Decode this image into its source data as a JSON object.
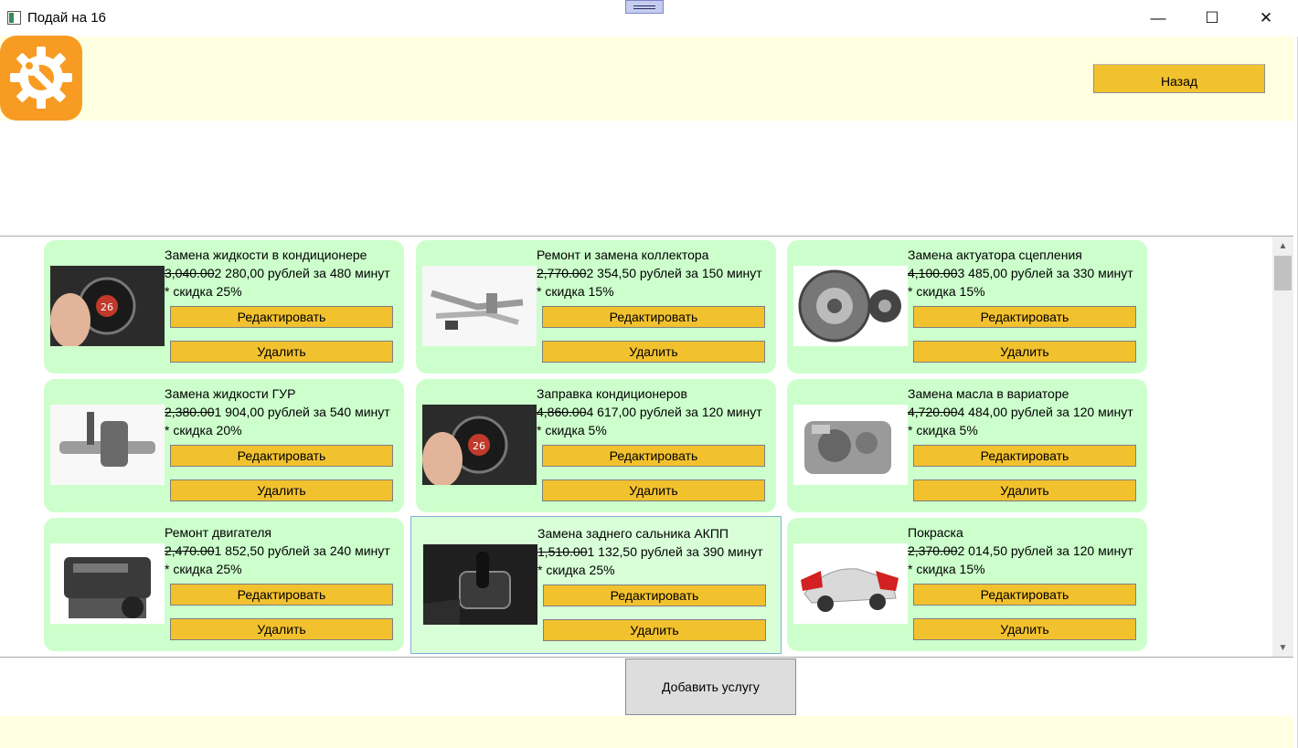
{
  "window": {
    "title": "Подай на 16",
    "controls": {
      "minimize": "—",
      "maximize": "☐",
      "close": "✕"
    }
  },
  "header": {
    "logo_icon": "wrench-gear-icon",
    "back_label": "Назад"
  },
  "colors": {
    "header_bg": "#ffffe1",
    "card_bg": "#ccffcc",
    "button_bg": "#f2c12e",
    "logo_bg": "#f79b22"
  },
  "services": [
    {
      "title": "Замена жидкости в кондиционере",
      "old_price": "3,040.00",
      "new_price": "2 280,00 рублей за 480 минут",
      "discount": "* скидка 25%",
      "image_icon": "ac-panel-image",
      "edit_label": "Редактировать",
      "delete_label": "Удалить"
    },
    {
      "title": "Ремонт и замена коллектора",
      "old_price": "2,770.00",
      "new_price": "2 354,50 рублей за 150 минут",
      "discount": "* скидка 15%",
      "image_icon": "exhaust-pipes-image",
      "edit_label": "Редактировать",
      "delete_label": "Удалить"
    },
    {
      "title": "Замена актуатора сцепления",
      "old_price": "4,100.00",
      "new_price": "3 485,00 рублей за 330 минут",
      "discount": "* скидка 15%",
      "image_icon": "clutch-kit-image",
      "edit_label": "Редактировать",
      "delete_label": "Удалить"
    },
    {
      "title": "Замена жидкости ГУР",
      "old_price": "2,380.00",
      "new_price": "1 904,00 рублей за 540 минут",
      "discount": "* скидка 20%",
      "image_icon": "steering-gear-image",
      "edit_label": "Редактировать",
      "delete_label": "Удалить"
    },
    {
      "title": "Заправка кондиционеров",
      "old_price": "4,860.00",
      "new_price": "4 617,00 рублей за 120 минут",
      "discount": "* скидка 5%",
      "image_icon": "ac-panel-image",
      "edit_label": "Редактировать",
      "delete_label": "Удалить"
    },
    {
      "title": "Замена масла в вариаторе",
      "old_price": "4,720.00",
      "new_price": "4 484,00 рублей за 120 минут",
      "discount": "* скидка 5%",
      "image_icon": "transmission-image",
      "edit_label": "Редактировать",
      "delete_label": "Удалить"
    },
    {
      "title": "Ремонт двигателя",
      "old_price": "2,470.00",
      "new_price": "1 852,50 рублей за 240 минут",
      "discount": "* скидка 25%",
      "image_icon": "engine-image",
      "edit_label": "Редактировать",
      "delete_label": "Удалить"
    },
    {
      "title": "Замена заднего сальника АКПП",
      "old_price": "1,510.00",
      "new_price": "1 132,50 рублей за 390 минут",
      "discount": "* скидка 25%",
      "image_icon": "gear-shifter-image",
      "edit_label": "Редактировать",
      "delete_label": "Удалить"
    },
    {
      "title": "Покраска",
      "old_price": "2,370.00",
      "new_price": "2 014,50 рублей за 120 минут",
      "discount": "* скидка 15%",
      "image_icon": "car-body-image",
      "edit_label": "Редактировать",
      "delete_label": "Удалить"
    }
  ],
  "footer": {
    "add_label": "Добавить услугу"
  }
}
